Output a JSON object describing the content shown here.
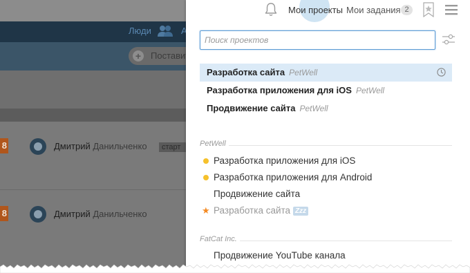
{
  "background_app": {
    "nav_people_label": "Люди",
    "nav_next_letter": "А",
    "add_button_label": "Поставить",
    "rows": [
      {
        "badge": "8",
        "first_name": "Дмитрий",
        "last_name": "Данильченко",
        "stage": "старт"
      },
      {
        "badge": "8",
        "first_name": "Дмитрий",
        "last_name": "Данильченко",
        "stage": ""
      }
    ]
  },
  "panel": {
    "tabs": {
      "my_projects": "Мои проекты",
      "my_tasks": "Мои задания",
      "my_tasks_count": "2"
    },
    "search": {
      "placeholder": "Поиск проектов",
      "value": ""
    },
    "recent": [
      {
        "name": "Разработка сайта",
        "owner": "PetWell",
        "active": true
      },
      {
        "name": "Разработка приложения для iOS",
        "owner": "PetWell",
        "active": false
      },
      {
        "name": "Продвижение сайта",
        "owner": "PetWell",
        "active": false
      }
    ],
    "groups": [
      {
        "name": "PetWell",
        "projects": [
          {
            "name": "Разработка приложения для iOS",
            "marker": "yellow-dot-icon"
          },
          {
            "name": "Разработка приложения для Android",
            "marker": "yellow-dot-icon"
          },
          {
            "name": "Продвижение сайта",
            "marker": ""
          },
          {
            "name": "Разработка сайта",
            "marker": "orange-star-icon",
            "badge": "Zzz",
            "muted": true
          }
        ]
      },
      {
        "name": "FatCat Inc.",
        "projects": [
          {
            "name": "Продвижение YouTube канала",
            "marker": ""
          }
        ]
      }
    ]
  },
  "colors": {
    "active_row": "#dbeaf7",
    "dot_yellow": "#f6c12c",
    "star_orange": "#f48a22",
    "search_border": "#5b9bd5"
  }
}
